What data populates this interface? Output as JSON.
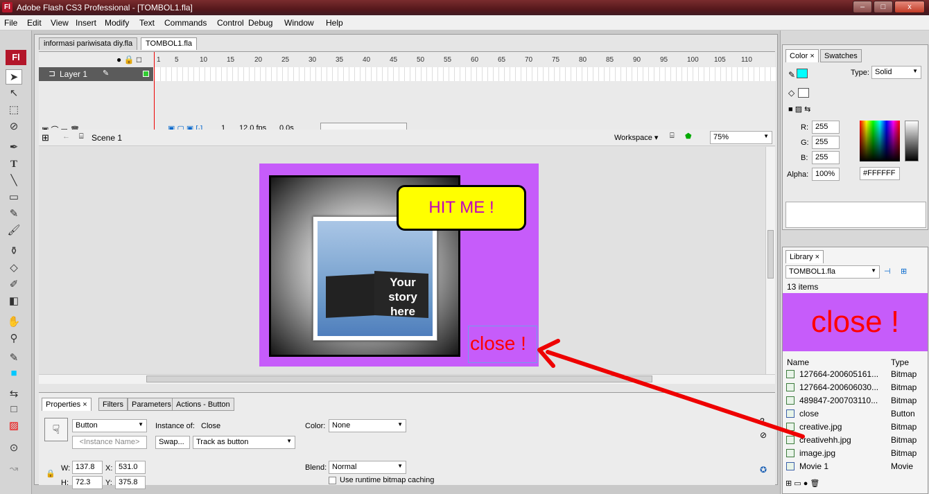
{
  "window": {
    "title": "Adobe Flash CS3 Professional - [TOMBOL1.fla]",
    "app_badge": "Fl",
    "min": "–",
    "max": "□",
    "close": "x"
  },
  "menu": [
    "File",
    "Edit",
    "View",
    "Insert",
    "Modify",
    "Text",
    "Commands",
    "Control",
    "Debug",
    "Window",
    "Help"
  ],
  "doc_tabs": [
    "informasi pariwisata diy.fla",
    "TOMBOL1.fla"
  ],
  "timeline": {
    "ruler": [
      "1",
      "5",
      "10",
      "15",
      "20",
      "25",
      "30",
      "35",
      "40",
      "45",
      "50",
      "55",
      "60",
      "65",
      "70",
      "75",
      "80",
      "85",
      "90",
      "95",
      "100",
      "105",
      "110"
    ],
    "layer": "Layer 1",
    "frame": "1",
    "fps": "12.0 fps",
    "time": "0.0s"
  },
  "scene": {
    "label": "Scene 1",
    "workspace": "Workspace ▾",
    "zoom": "75%"
  },
  "stage": {
    "hit_me": "HIT  ME !",
    "book_text": "Your story here",
    "close_label": "close !"
  },
  "properties": {
    "tabs": [
      "Properties ×",
      "Filters",
      "Parameters",
      "Actions - Button"
    ],
    "type": "Button",
    "instance_of_label": "Instance of:",
    "instance_of": "Close",
    "instance_name_placeholder": "<Instance Name>",
    "swap": "Swap...",
    "track": "Track as button",
    "color_label": "Color:",
    "color": "None",
    "blend_label": "Blend:",
    "blend": "Normal",
    "bitmap_caching": "Use runtime bitmap caching",
    "w_label": "W:",
    "w": "137.8",
    "x_label": "X:",
    "x": "531.0",
    "h_label": "H:",
    "h": "72.3",
    "y_label": "Y:",
    "y": "375.8"
  },
  "color_panel": {
    "tabs": [
      "Color ×",
      "Swatches"
    ],
    "type_label": "Type:",
    "type": "Solid",
    "r_label": "R:",
    "r": "255",
    "g_label": "G:",
    "g": "255",
    "b_label": "B:",
    "b": "255",
    "alpha_label": "Alpha:",
    "alpha": "100%",
    "hex": "#FFFFFF",
    "accent": "#00ffff"
  },
  "library": {
    "tab": "Library ×",
    "file": "TOMBOL1.fla",
    "count": "13 items",
    "preview": "close !",
    "col_name": "Name",
    "col_type": "Type",
    "items": [
      {
        "name": "127664-200605161...",
        "type": "Bitmap"
      },
      {
        "name": "127664-200606030...",
        "type": "Bitmap"
      },
      {
        "name": "489847-200703110...",
        "type": "Bitmap"
      },
      {
        "name": "close",
        "type": "Button"
      },
      {
        "name": "creative.jpg",
        "type": "Bitmap"
      },
      {
        "name": "creativehh.jpg",
        "type": "Bitmap"
      },
      {
        "name": "image.jpg",
        "type": "Bitmap"
      },
      {
        "name": "Movie 1",
        "type": "Movie"
      }
    ]
  },
  "colors": {
    "stage_bg": "#c65cfa",
    "hit_me_fill": "#ffff00",
    "close_text": "#ff0000",
    "arrow": "#ee0000"
  }
}
